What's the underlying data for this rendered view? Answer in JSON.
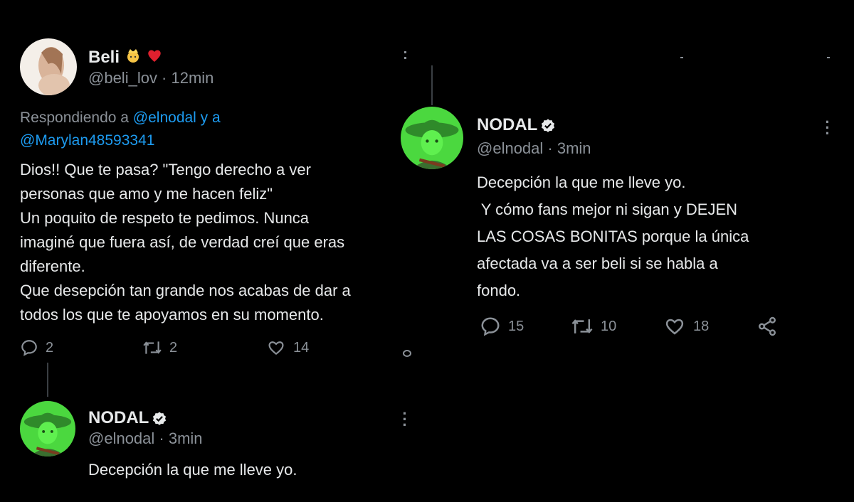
{
  "left_tweet": {
    "name": "Beli",
    "handle_time": "@beli_lov · 12min",
    "reply_prefix": "Respondiendo a ",
    "reply_mention_1": "@elnodal y a",
    "reply_mention_2": "@Marylan48593341",
    "body_lines": [
      "Dios!! Que te pasa? \"Tengo derecho a ver",
      "personas que amo y me hacen feliz\"",
      "Un poquito de respeto te pedimos. Nunca",
      "imaginé que fuera así, de verdad creí que eras",
      "diferente.",
      "Que desepción tan grande nos acabas de dar a",
      "todos los que te apoyamos en su momento."
    ],
    "replies": "2",
    "retweets": "2",
    "likes": "14"
  },
  "left_reply": {
    "name": "NODAL",
    "handle_time": "@elnodal · 3min",
    "body": "Decepción la que me lleve yo."
  },
  "right_tweet": {
    "name": "NODAL",
    "handle_time": "@elnodal · 3min",
    "body_lines": [
      "Decepción la que me lleve yo.",
      " Y cómo fans mejor ni sigan y DEJEN",
      "LAS COSAS BONITAS porque la única",
      "afectada va a ser beli si se habla a",
      "fondo."
    ],
    "replies": "15",
    "retweets": "10",
    "likes": "18"
  },
  "icons": {
    "reply": "reply-icon",
    "retweet": "retweet-icon",
    "like": "heart-icon",
    "share": "share-icon",
    "verified": "verified-badge-icon",
    "more": "more-options-icon"
  },
  "colors": {
    "background": "#000000",
    "text": "#e7e9ea",
    "muted": "#8b9198",
    "link": "#1d9bf0"
  }
}
